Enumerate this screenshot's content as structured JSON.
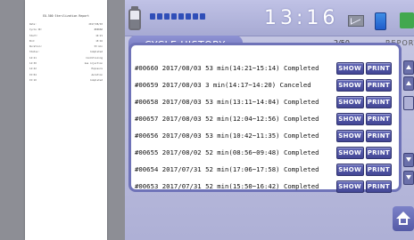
{
  "receipt": {
    "title": "EO-500 Sterilization Report",
    "lines": [
      [
        "Date:",
        "2017/08/03"
      ],
      [
        "Cycle ID:",
        "#00660"
      ],
      [
        "Start:",
        "14:21"
      ],
      [
        "End:",
        "15:16"
      ],
      [
        "Duration:",
        "53 min"
      ],
      [
        "Status:",
        "Completed"
      ],
      [
        "",
        ""
      ],
      [
        "14:21",
        "Conditioning"
      ],
      [
        "14:30",
        "Gas injection"
      ],
      [
        "14:42",
        "Exposure"
      ],
      [
        "15:04",
        "Aeration"
      ],
      [
        "15:10",
        "Completed"
      ]
    ]
  },
  "topbar": {
    "time": "13:16",
    "progress_segments": 8
  },
  "panel": {
    "title": "CYCLE HISTORY",
    "page": "2/50",
    "report_label": "REPORT",
    "show_label": "SHOW",
    "print_label": "PRINT",
    "rows": [
      "#00660  2017/08/03  53 min(14:21~15:14) Completed",
      "#00659  2017/08/03   3 min(14:17~14:20) Canceled",
      "#00658  2017/08/03  53 min(13:11~14:04) Completed",
      "#00657  2017/08/03  52 min(12:04~12:56) Completed",
      "#00656  2017/08/03  53 min(10:42~11:35) Completed",
      "#00655  2017/08/02  52 min(08:56~09:48) Completed",
      "#00654  2017/07/31  52 min(17:06~17:58) Completed",
      "#00653  2017/07/31  52 min(15:50~16:42) Completed"
    ]
  }
}
